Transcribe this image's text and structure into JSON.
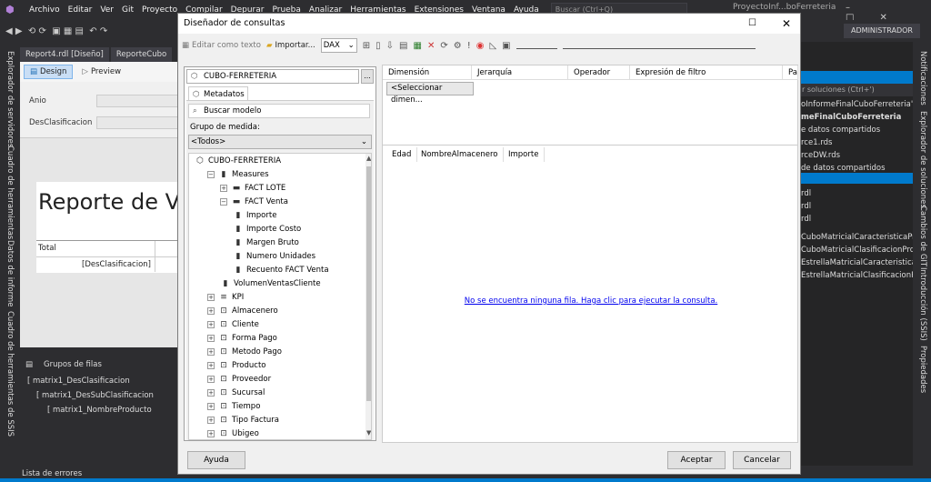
{
  "app": {
    "menu": [
      "Archivo",
      "Editar",
      "Ver",
      "Git",
      "Proyecto",
      "Compilar",
      "Depurar",
      "Prueba",
      "Analizar",
      "Herramientas",
      "Extensiones",
      "Ventana",
      "Ayuda"
    ],
    "search_placeholder": "Buscar (Ctrl+Q)",
    "project_name": "ProyectoInf...boFerreteria",
    "user": "ADMINISTRADOR"
  },
  "left_strip": [
    "Explorador de servidores",
    "Cuadro de herramientas",
    "Datos de informe",
    "Cuadro de herramientas de SSIS"
  ],
  "doc_tabs": [
    "Report4.rdl [Diseño]",
    "ReporteCubo"
  ],
  "design": {
    "design_label": "Design",
    "preview_label": "Preview"
  },
  "params": [
    "Anio",
    "DesClasificacion"
  ],
  "report": {
    "title": "Reporte de Ve",
    "total": "Total",
    "cell": "[DesClasificacion]"
  },
  "row_groups": {
    "header": "Grupos de filas",
    "items": [
      "matrix1_DesClasificacion",
      "matrix1_DesSubClasificacion",
      "matrix1_NombreProducto"
    ]
  },
  "error_list": "Lista de errores",
  "right_panel": {
    "search": "r soluciones (Ctrl+')",
    "items": [
      "oInformeFinalCuboFerreteria' (",
      "meFinalCuboFerreteria",
      "e datos compartidos",
      "rce1.rds",
      "rceDW.rds",
      "de datos compartidos",
      "",
      "rdl",
      "rdl",
      "rdl",
      "CuboMatricialCaracteristicaPro",
      "CuboMatricialClasificacionProc",
      "EstrellaMatricialCaracteristicaPr",
      "EstrellaMatricialClasificacionPro"
    ]
  },
  "right_strip": [
    "Notificaciones",
    "Explorador de soluciones",
    "Cambios de GIT",
    "Introducción (SSIS)",
    "Propiedades"
  ],
  "dialog": {
    "title": "Diseñador de consultas",
    "toolbar": {
      "edit_text": "Editar como texto",
      "import": "Importar...",
      "lang": "DAX"
    },
    "cube": "CUBO-FERRETERIA",
    "cube_btn": "...",
    "meta_tab": "Metadatos",
    "search_model": "Buscar modelo",
    "measure_group_label": "Grupo de medida:",
    "measure_group": "<Todos>",
    "tree": [
      {
        "label": "CUBO-FERRETERIA",
        "level": 0,
        "exp": "",
        "icon": "cube-icon"
      },
      {
        "label": "Measures",
        "level": 1,
        "exp": "⊟",
        "icon": "measures-icon"
      },
      {
        "label": "FACT LOTE",
        "level": 2,
        "exp": "⊞",
        "icon": "folder-icon"
      },
      {
        "label": "FACT Venta",
        "level": 2,
        "exp": "⊟",
        "icon": "folder-icon"
      },
      {
        "label": "Importe",
        "level": 3,
        "exp": "",
        "icon": "measure-icon"
      },
      {
        "label": "Importe Costo",
        "level": 3,
        "exp": "",
        "icon": "measure-icon"
      },
      {
        "label": "Margen Bruto",
        "level": 3,
        "exp": "",
        "icon": "measure-icon"
      },
      {
        "label": "Numero Unidades",
        "level": 3,
        "exp": "",
        "icon": "measure-icon"
      },
      {
        "label": "Recuento FACT Venta",
        "level": 3,
        "exp": "",
        "icon": "measure-icon"
      },
      {
        "label": "VolumenVentasCliente",
        "level": 2,
        "exp": "",
        "icon": "calc-measure-icon"
      },
      {
        "label": "KPI",
        "level": 1,
        "exp": "⊞",
        "icon": "kpi-icon"
      },
      {
        "label": "Almacenero",
        "level": 1,
        "exp": "⊞",
        "icon": "dimension-icon"
      },
      {
        "label": "Cliente",
        "level": 1,
        "exp": "⊞",
        "icon": "dimension-icon"
      },
      {
        "label": "Forma Pago",
        "level": 1,
        "exp": "⊞",
        "icon": "dimension-icon"
      },
      {
        "label": "Metodo Pago",
        "level": 1,
        "exp": "⊞",
        "icon": "dimension-icon"
      },
      {
        "label": "Producto",
        "level": 1,
        "exp": "⊞",
        "icon": "dimension-icon"
      },
      {
        "label": "Proveedor",
        "level": 1,
        "exp": "⊞",
        "icon": "dimension-icon"
      },
      {
        "label": "Sucursal",
        "level": 1,
        "exp": "⊞",
        "icon": "dimension-icon"
      },
      {
        "label": "Tiempo",
        "level": 1,
        "exp": "⊞",
        "icon": "dimension-icon"
      },
      {
        "label": "Tipo Factura",
        "level": 1,
        "exp": "⊞",
        "icon": "dimension-icon"
      },
      {
        "label": "Ubigeo",
        "level": 1,
        "exp": "⊞",
        "icon": "dimension-icon"
      }
    ],
    "filter_headers": [
      "Dimensión",
      "Jerarquía",
      "Operador",
      "Expresión de filtro",
      "Par"
    ],
    "select_dimension": "<Seleccionar dimen...",
    "result_headers": [
      "Edad",
      "NombreAlmacenero",
      "Importe"
    ],
    "no_rows": "No se encuentra ninguna fila. Haga clic para ejecutar la consulta.",
    "help": "Ayuda",
    "accept": "Aceptar",
    "cancel": "Cancelar"
  }
}
